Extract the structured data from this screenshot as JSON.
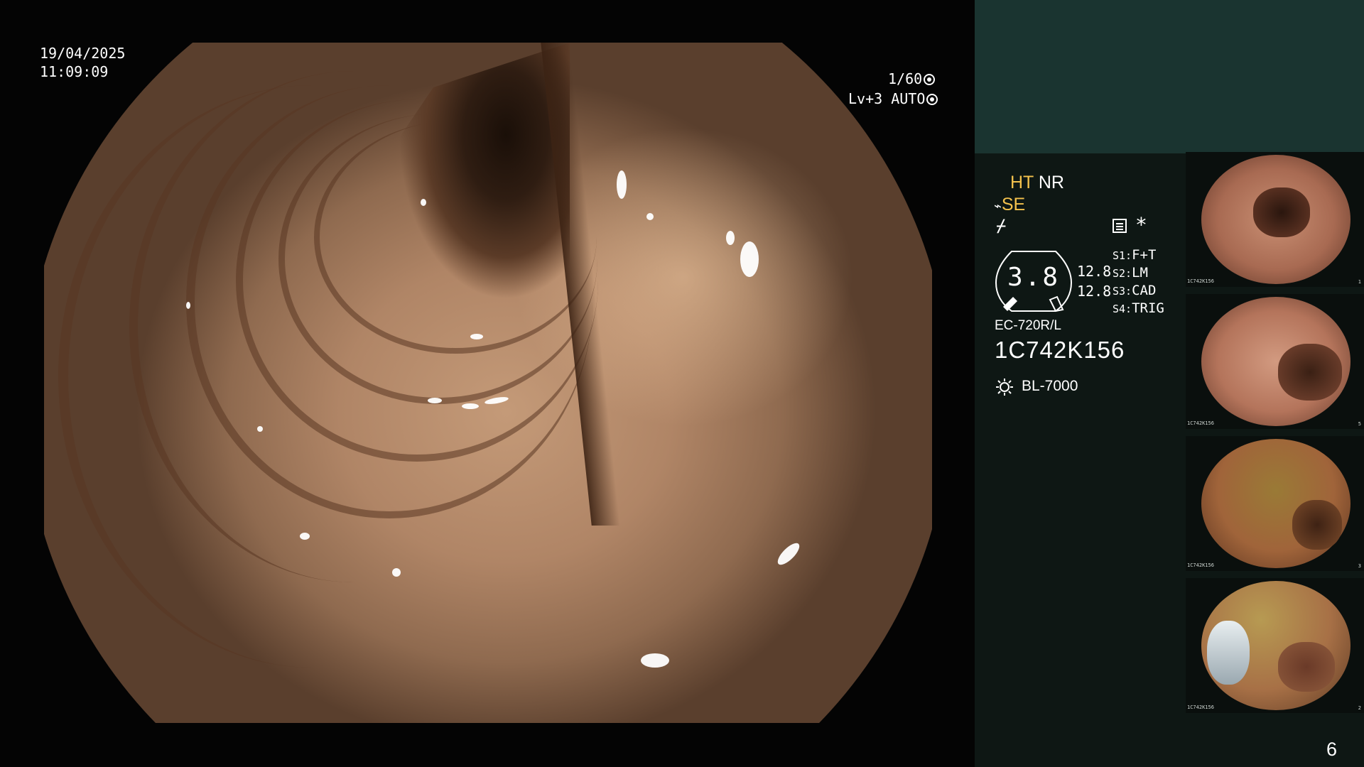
{
  "overlay": {
    "date": "19/04/2025",
    "time": "11:09:09",
    "shutter": "1/60",
    "level": "Lv+3 AUTO"
  },
  "panel": {
    "mode_ht": "HT",
    "mode_nr": "NR",
    "mode_se": "SE",
    "star": "*",
    "gauge_value": "3.8",
    "value_1": "12.8",
    "value_2": "12.8",
    "settings": [
      {
        "key": "S1:",
        "label": "F+T"
      },
      {
        "key": "S2:",
        "label": "LM"
      },
      {
        "key": "S3:",
        "label": "CAD"
      },
      {
        "key": "S4:",
        "label": "TRIG"
      }
    ],
    "scope_model": "EC-720R/L",
    "scope_serial": "1C742K156",
    "light_source": "BL-7000",
    "accent_color": "#f4c24d"
  },
  "thumbnails": [
    {
      "caption": "1C742K156",
      "index": "1",
      "tone": "pink"
    },
    {
      "caption": "1C742K156",
      "index": "5",
      "tone": "pink"
    },
    {
      "caption": "1C742K156",
      "index": "3",
      "tone": "yellow"
    },
    {
      "caption": "1C742K156",
      "index": "2",
      "tone": "yellow"
    }
  ],
  "page_number": "6"
}
